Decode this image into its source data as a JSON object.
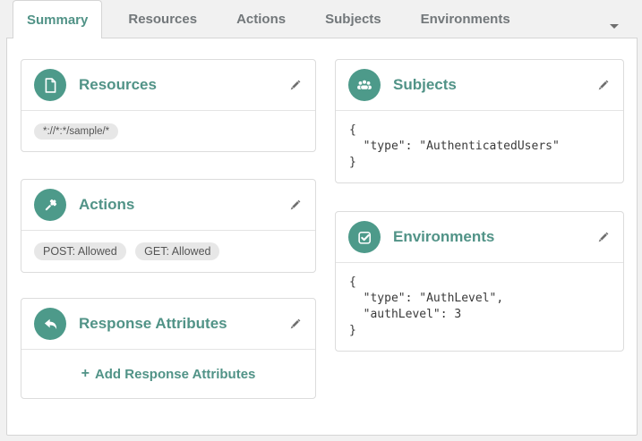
{
  "colors": {
    "accent_teal": "#519387",
    "icon_circle_teal": "#4d9a8a",
    "inactive_tab_gray": "#72777a",
    "badge_bg": "#e7e7e7",
    "page_bg": "#f1f1f1"
  },
  "tabs": {
    "items": [
      {
        "label": "Summary",
        "active": true
      },
      {
        "label": "Resources",
        "active": false
      },
      {
        "label": "Actions",
        "active": false
      },
      {
        "label": "Subjects",
        "active": false
      },
      {
        "label": "Environments",
        "active": false
      }
    ],
    "overflow_icon": "caret-down-icon"
  },
  "cards": {
    "resources": {
      "title": "Resources",
      "icon": "file-icon",
      "edit_icon": "pencil-icon",
      "badges": [
        "*://*:*/sample/*"
      ]
    },
    "actions": {
      "title": "Actions",
      "icon": "gavel-icon",
      "edit_icon": "pencil-icon",
      "badges": [
        "POST: Allowed",
        "GET: Allowed"
      ]
    },
    "response_attributes": {
      "title": "Response Attributes",
      "icon": "reply-arrow-icon",
      "edit_icon": "pencil-icon",
      "add_icon": "+",
      "add_label": "Add Response Attributes"
    },
    "subjects": {
      "title": "Subjects",
      "icon": "users-icon",
      "edit_icon": "pencil-icon",
      "json_text": "{\n  \"type\": \"AuthenticatedUsers\"\n}"
    },
    "environments": {
      "title": "Environments",
      "icon": "check-square-icon",
      "edit_icon": "pencil-icon",
      "json_text": "{\n  \"type\": \"AuthLevel\",\n  \"authLevel\": 3\n}"
    }
  }
}
